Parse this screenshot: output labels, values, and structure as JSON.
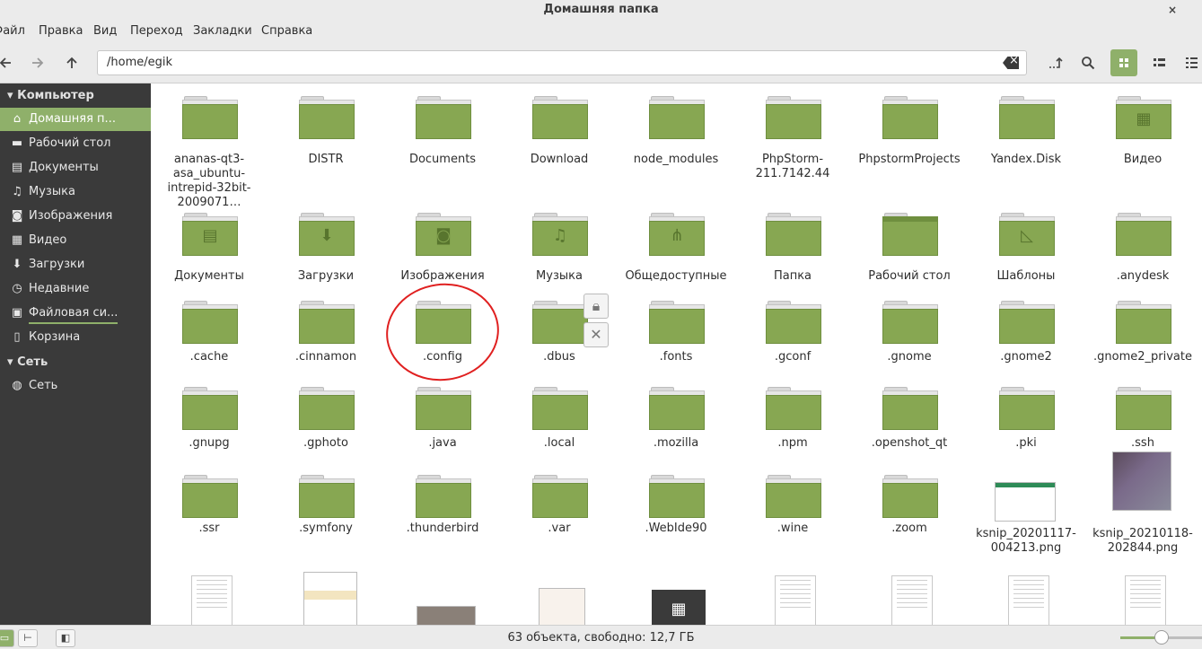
{
  "window": {
    "title": "Домашняя папка",
    "close_glyph": "×"
  },
  "menu": [
    "Файл",
    "Правка",
    "Вид",
    "Переход",
    "Закладки",
    "Справка"
  ],
  "toolbar": {
    "back_icon": "arrow-left-icon",
    "forward_icon": "arrow-right-icon",
    "up_icon": "arrow-up-icon",
    "path": "/home/egik",
    "view_mode": "icons"
  },
  "sidebar": {
    "computer_header": "Компьютер",
    "network_header": "Сеть",
    "items": [
      {
        "label": "Домашняя п...",
        "icon": "home-icon",
        "glyph": "⌂"
      },
      {
        "label": "Рабочий стол",
        "icon": "desktop-icon",
        "glyph": "▬"
      },
      {
        "label": "Документы",
        "icon": "document-icon",
        "glyph": "▤"
      },
      {
        "label": "Музыка",
        "icon": "music-icon",
        "glyph": "♫"
      },
      {
        "label": "Изображения",
        "icon": "camera-icon",
        "glyph": "◙"
      },
      {
        "label": "Видео",
        "icon": "film-icon",
        "glyph": "▦"
      },
      {
        "label": "Загрузки",
        "icon": "download-icon",
        "glyph": "⬇"
      },
      {
        "label": "Недавние",
        "icon": "clock-icon",
        "glyph": "◷"
      },
      {
        "label": "Файловая си...",
        "icon": "drive-icon",
        "glyph": "▣"
      },
      {
        "label": "Корзина",
        "icon": "trash-icon",
        "glyph": "▯"
      }
    ],
    "network_items": [
      {
        "label": "Сеть",
        "icon": "network-icon",
        "glyph": "◍"
      }
    ]
  },
  "files": [
    {
      "name": "ananas-qt3-asa_ubuntu-intrepid-32bit-2009071…",
      "type": "folder"
    },
    {
      "name": "DISTR",
      "type": "folder"
    },
    {
      "name": "Documents",
      "type": "folder"
    },
    {
      "name": "Download",
      "type": "folder"
    },
    {
      "name": "node_modules",
      "type": "folder"
    },
    {
      "name": "PhpStorm-211.7142.44",
      "type": "folder"
    },
    {
      "name": "PhpstormProjects",
      "type": "folder"
    },
    {
      "name": "Yandex.Disk",
      "type": "folder"
    },
    {
      "name": "Видео",
      "type": "folder",
      "emblem": "film",
      "glyph": "▦"
    },
    {
      "name": "Документы",
      "type": "folder",
      "emblem": "document",
      "glyph": "▤"
    },
    {
      "name": "Загрузки",
      "type": "folder",
      "emblem": "download",
      "glyph": "⬇"
    },
    {
      "name": "Изображения",
      "type": "folder",
      "emblem": "camera",
      "glyph": "◙"
    },
    {
      "name": "Музыка",
      "type": "folder",
      "emblem": "music",
      "glyph": "♫"
    },
    {
      "name": "Общедоступные",
      "type": "folder",
      "emblem": "share",
      "glyph": "⋔"
    },
    {
      "name": "Папка",
      "type": "folder"
    },
    {
      "name": "Рабочий стол",
      "type": "folder",
      "emblem": "desktop",
      "glyph": ""
    },
    {
      "name": "Шаблоны",
      "type": "folder",
      "emblem": "template",
      "glyph": "◺"
    },
    {
      "name": ".anydesk",
      "type": "folder"
    },
    {
      "name": ".cache",
      "type": "folder"
    },
    {
      "name": ".cinnamon",
      "type": "folder"
    },
    {
      "name": ".config",
      "type": "folder",
      "highlighted": true
    },
    {
      "name": ".dbus",
      "type": "folder",
      "locked": true
    },
    {
      "name": ".fonts",
      "type": "folder"
    },
    {
      "name": ".gconf",
      "type": "folder"
    },
    {
      "name": ".gnome",
      "type": "folder"
    },
    {
      "name": ".gnome2",
      "type": "folder"
    },
    {
      "name": ".gnome2_private",
      "type": "folder"
    },
    {
      "name": ".gnupg",
      "type": "folder"
    },
    {
      "name": ".gphoto",
      "type": "folder"
    },
    {
      "name": ".java",
      "type": "folder"
    },
    {
      "name": ".local",
      "type": "folder"
    },
    {
      "name": ".mozilla",
      "type": "folder"
    },
    {
      "name": ".npm",
      "type": "folder"
    },
    {
      "name": ".openshot_qt",
      "type": "folder"
    },
    {
      "name": ".pki",
      "type": "folder"
    },
    {
      "name": ".ssh",
      "type": "folder"
    },
    {
      "name": ".ssr",
      "type": "folder"
    },
    {
      "name": ".symfony",
      "type": "folder"
    },
    {
      "name": ".thunderbird",
      "type": "folder"
    },
    {
      "name": ".var",
      "type": "folder"
    },
    {
      "name": ".WebIde90",
      "type": "folder"
    },
    {
      "name": ".wine",
      "type": "folder"
    },
    {
      "name": ".zoom",
      "type": "folder"
    },
    {
      "name": "ksnip_20201117-004213.png",
      "type": "image"
    },
    {
      "name": "ksnip_20210118-202844.png",
      "type": "image"
    },
    {
      "name": "",
      "type": "document"
    },
    {
      "name": "",
      "type": "image"
    },
    {
      "name": "",
      "type": "image"
    },
    {
      "name": "",
      "type": "image"
    },
    {
      "name": "",
      "type": "video"
    },
    {
      "name": "",
      "type": "document"
    },
    {
      "name": "",
      "type": "document"
    },
    {
      "name": "",
      "type": "document"
    },
    {
      "name": "",
      "type": "document"
    }
  ],
  "emblems": {
    "lock_glyph": "🔒︎",
    "close_glyph": "✕"
  },
  "status": {
    "text": "63 объекта, свободно: 12,7 ГБ",
    "zoom_level": 0.5
  },
  "colors": {
    "accent": "#8fb06a",
    "folder": "#87a752",
    "annotation": "#e02020"
  }
}
